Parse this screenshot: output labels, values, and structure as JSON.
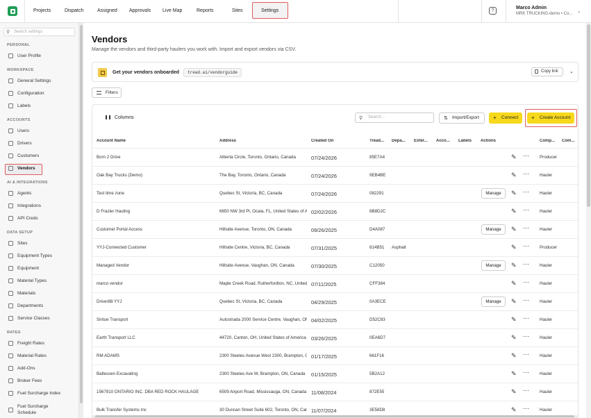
{
  "topbar": {
    "nav": [
      "Projects",
      "Dispatch",
      "Assigned",
      "Approvals",
      "Live Map",
      "Reports",
      "Sites",
      "Settings"
    ],
    "active": "Settings",
    "user_name": "Marco Admin",
    "user_org": "MRK TRUCKING-demo • Co..."
  },
  "sidebar": {
    "search_placeholder": "Search settings",
    "sections": [
      {
        "title": "PERSONAL",
        "items": [
          "User Profile"
        ]
      },
      {
        "title": "WORKSPACE",
        "items": [
          "General Settings",
          "Configuration",
          "Labels"
        ]
      },
      {
        "title": "ACCOUNTS",
        "items": [
          "Users",
          "Drivers",
          "Customers",
          "Vendors"
        ]
      },
      {
        "title": "AI & INTEGRATIONS",
        "items": [
          "Agents",
          "Integrations",
          "API Creds"
        ]
      },
      {
        "title": "DATA SETUP",
        "items": [
          "Sites",
          "Equipment Types",
          "Equipment",
          "Material Types",
          "Materials",
          "Departments",
          "Service Classes"
        ]
      },
      {
        "title": "RATES",
        "items": [
          "Freight Rates",
          "Material Rates",
          "Add-Ons",
          "Broker Fees",
          "Fuel Surcharge Index",
          "Fuel Surcharge Schedule"
        ]
      }
    ],
    "active": "Vendors"
  },
  "page": {
    "title": "Vendors",
    "subtitle": "Manage the vendors and third-party haulers you work with. Import and export vendors via CSV.",
    "banner_title": "Get your vendors onboarded",
    "banner_code": "tread.ai/vendorguide",
    "copy_link": "Copy link",
    "filters": "Filters"
  },
  "table": {
    "columns_label": "Columns",
    "search_placeholder": "Search...",
    "import_export": "Import/Export",
    "connect": "Connect",
    "create_account": "Create Account",
    "headers": [
      "Account Name",
      "Address",
      "Created On",
      "Tread...",
      "Depa...",
      "Exter...",
      "Acco...",
      "Labels",
      "Actions",
      "Comp...",
      "Com..."
    ],
    "rows": [
      {
        "name": "Born 2 Drive",
        "address": "Alberta Circle, Toronto, Ontario, Canada",
        "created": "07/24/2026",
        "tread": "85E7A4",
        "dept": "",
        "manage": false,
        "comp": "Producer"
      },
      {
        "name": "Oak Bay Trucks (Demo)",
        "address": "The Bay, Toronto, Ontario, Canada",
        "created": "07/24/2026",
        "tread": "9EB4BE",
        "dept": "",
        "manage": false,
        "comp": "Hauler"
      },
      {
        "name": "Test time zone",
        "address": "Quebec St, Victoria, BC, Canada",
        "created": "07/24/2026",
        "tread": "082291",
        "dept": "",
        "manage": true,
        "comp": "Hauler"
      },
      {
        "name": "D Frazier Hauling",
        "address": "6650 NW 3rd Pl, Ocala, FL, United States of America",
        "created": "02/02/2026",
        "tread": "8B8D2C",
        "dept": "",
        "manage": false,
        "comp": "Hauler"
      },
      {
        "name": "Customer Portal Access",
        "address": "Hillside Avenue, Toronto, ON, Canada",
        "created": "09/26/2025",
        "tread": "D4A087",
        "dept": "",
        "manage": true,
        "comp": "Hauler"
      },
      {
        "name": "YYJ-Connected Customer",
        "address": "Hillside Centre, Victoria, BC, Canada",
        "created": "07/31/2025",
        "tread": "814B51",
        "dept": "Asphalt",
        "manage": false,
        "comp": "Producer"
      },
      {
        "name": "Managed Vendor",
        "address": "Hillside Avenue, Vaughan, ON, Canada",
        "created": "07/30/2025",
        "tread": "C12050",
        "dept": "",
        "manage": true,
        "comp": "Hauler"
      },
      {
        "name": "marco vendor",
        "address": "Maple Creek Road, Rutherfordton, NC, United States",
        "created": "07/11/2025",
        "tread": "CFF384",
        "dept": "",
        "manage": false,
        "comp": "Hauler"
      },
      {
        "name": "Driver88 YYJ",
        "address": "Quebec St, Victoria, BC, Canada",
        "created": "04/29/2025",
        "tread": "0A3ECE",
        "dept": "",
        "manage": true,
        "comp": "Hauler"
      },
      {
        "name": "Sintue Transport",
        "address": "Autostrada 2000 Service Centre, Vaughan, ON",
        "created": "04/02/2025",
        "tread": "D52C83",
        "dept": "",
        "manage": false,
        "comp": "Hauler"
      },
      {
        "name": "Earth Transport LLC",
        "address": "44720, Canton, OH, United States of America",
        "created": "03/26/2025",
        "tread": "0EA6D7",
        "dept": "",
        "manage": false,
        "comp": "Hauler"
      },
      {
        "name": "RM ADAMS",
        "address": "2300 Steeles Avenue West 2300, Brampton, ON",
        "created": "01/17/2025",
        "tread": "661F16",
        "dept": "",
        "manage": false,
        "comp": "Hauler"
      },
      {
        "name": "Baltessen Excavating",
        "address": "2300 Steeles Ave W, Brampton, ON, Canada",
        "created": "01/15/2025",
        "tread": "5B2A12",
        "dept": "",
        "manage": false,
        "comp": "Hauler"
      },
      {
        "name": "1567910 ONTARIO INC. DBA RED ROCK HAULAGE",
        "address": "6509 Airport Road, Mississauga, ON, Canada",
        "created": "11/08/2024",
        "tread": "872E55",
        "dept": "",
        "manage": false,
        "comp": "Hauler"
      },
      {
        "name": "Bulk Transfer Systems Inc",
        "address": "30 Duncan Street Suite 602, Toronto, ON, Canada",
        "created": "11/07/2024",
        "tread": "3E58D8",
        "dept": "",
        "manage": false,
        "comp": "Hauler"
      }
    ],
    "manage_label": "Manage"
  }
}
